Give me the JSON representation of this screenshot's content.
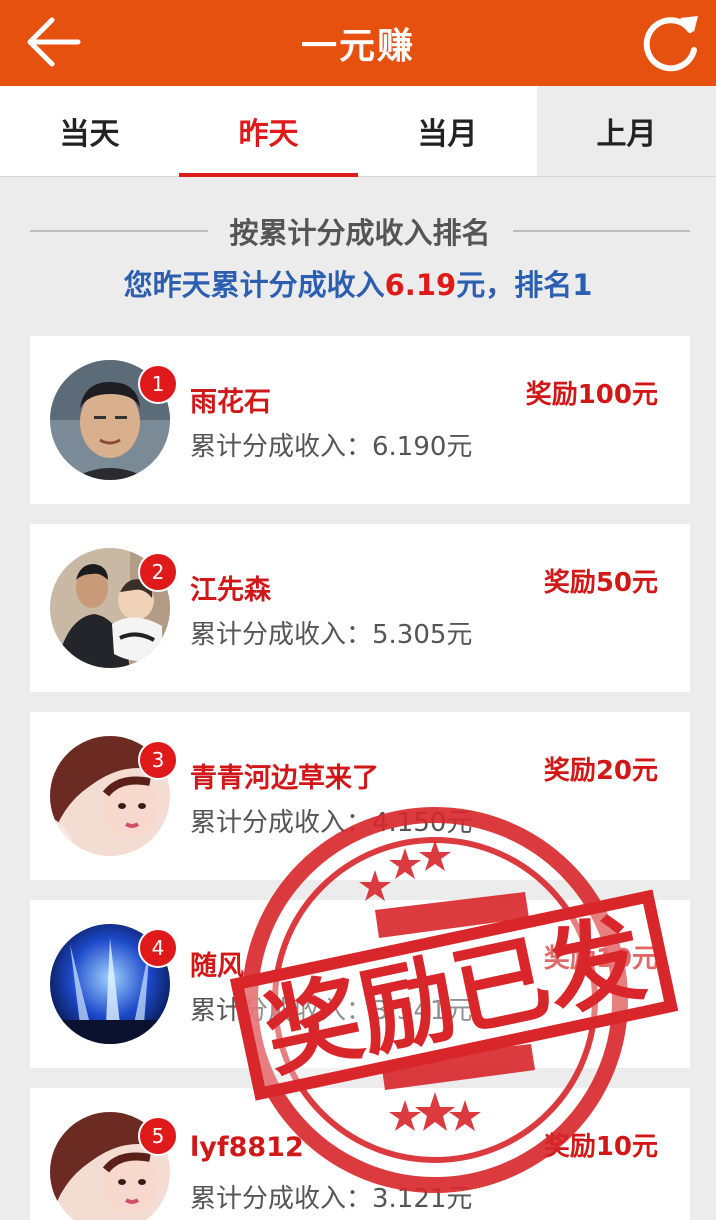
{
  "header": {
    "title": "一元赚",
    "back_icon": "back-arrow-icon",
    "refresh_icon": "refresh-icon",
    "bg_color": "#e65110"
  },
  "tabs": [
    {
      "label": "当天",
      "active": false
    },
    {
      "label": "昨天",
      "active": true
    },
    {
      "label": "当月",
      "active": false
    },
    {
      "label": "上月",
      "active": false
    }
  ],
  "section": {
    "title": "按累计分成收入排名"
  },
  "summary": {
    "prefix": "您昨天累计分成收入",
    "amount": "6.19",
    "suffix": "元，排名1"
  },
  "ranking": [
    {
      "rank": "1",
      "name": "雨花石",
      "income": "累计分成收入：6.190元",
      "reward": "奖励100元"
    },
    {
      "rank": "2",
      "name": "江先森",
      "income": "累计分成收入：5.305元",
      "reward": "奖励50元"
    },
    {
      "rank": "3",
      "name": "青青河边草来了",
      "income": "累计分成收入：4.150元",
      "reward": "奖励20元"
    },
    {
      "rank": "4",
      "name": "随风",
      "income": "累计分成收入：3.341元",
      "reward": "奖励10元"
    },
    {
      "rank": "5",
      "name": "lyf8812",
      "income": "累计分成收入：3.121元",
      "reward": "奖励10元"
    }
  ],
  "stamp": {
    "text": "奖励已发",
    "color": "#d8262a"
  },
  "colors": {
    "accent_red": "#e01a1a",
    "summary_blue": "#2c5fb0"
  }
}
